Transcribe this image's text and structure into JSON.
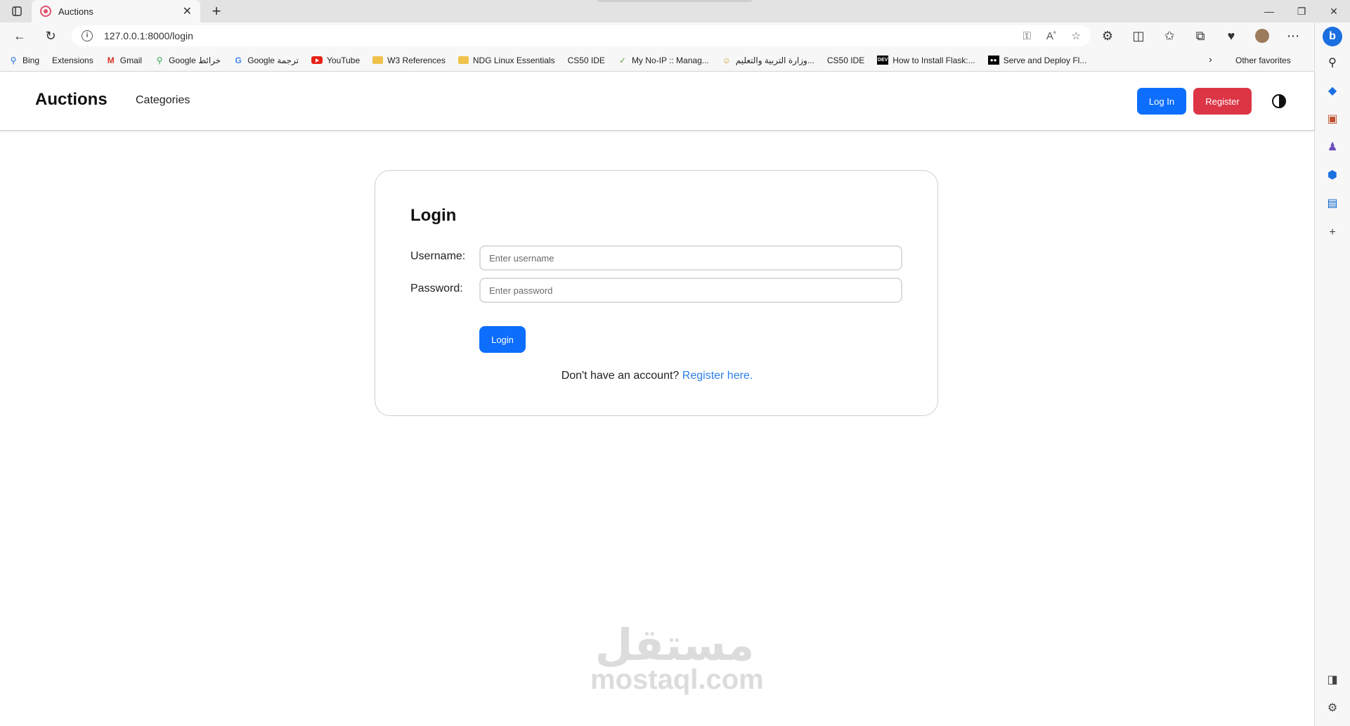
{
  "browser": {
    "tab_title": "Auctions",
    "url": "127.0.0.1:8000/login",
    "bookmarks": [
      {
        "label": "Bing",
        "icon": "search-icon"
      },
      {
        "label": "Extensions",
        "icon": "page-icon"
      },
      {
        "label": "Gmail",
        "icon": "gmail-icon"
      },
      {
        "label": "Google خرائط",
        "icon": "map-pin-icon"
      },
      {
        "label": "Google ترجمة",
        "icon": "translate-icon"
      },
      {
        "label": "YouTube",
        "icon": "youtube-icon"
      },
      {
        "label": "W3 References",
        "icon": "folder-icon"
      },
      {
        "label": "NDG Linux Essentials",
        "icon": "folder-icon"
      },
      {
        "label": "CS50 IDE",
        "icon": "page-icon"
      },
      {
        "label": "My No-IP :: Manag...",
        "icon": "noip-icon"
      },
      {
        "label": "وزارة التربية والتعليم...",
        "icon": "ministry-icon"
      },
      {
        "label": "CS50 IDE",
        "icon": "page-icon"
      },
      {
        "label": "How to Install Flask:...",
        "icon": "dev-icon"
      },
      {
        "label": "Serve and Deploy Fl...",
        "icon": "medium-icon"
      }
    ],
    "other_favorites": "Other favorites"
  },
  "navbar": {
    "brand": "Auctions",
    "categories": "Categories",
    "login": "Log In",
    "register": "Register"
  },
  "login_form": {
    "heading": "Login",
    "username_label": "Username:",
    "username_placeholder": "Enter username",
    "password_label": "Password:",
    "password_placeholder": "Enter password",
    "submit": "Login",
    "register_prompt": "Don't have an account?",
    "register_link": "Register here."
  },
  "watermark": {
    "arabic": "مستقل",
    "latin": "mostaql.com"
  },
  "colors": {
    "primary": "#0d6efd",
    "danger": "#dc3545",
    "link": "#2d7ee8"
  }
}
